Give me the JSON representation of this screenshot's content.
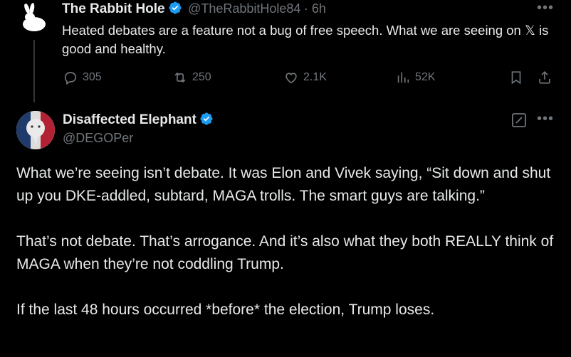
{
  "tweet1": {
    "author_name": "The Rabbit Hole",
    "handle": "@TheRabbitHole84",
    "time": "· 6h",
    "text": "Heated debates are a feature not a bug of free speech. What we are seeing on 𝕏 is good and healthy.",
    "stats": {
      "replies": "305",
      "reposts": "250",
      "likes": "2.1K",
      "views": "52K"
    }
  },
  "tweet2": {
    "author_name": "Disaffected Elephant",
    "handle": "@DEGOPer",
    "paragraphs": [
      "What we’re seeing isn’t debate. It was Elon and Vivek saying, “Sit down and shut up you DKE-addled, subtard, MAGA trolls. The smart guys are talking.”",
      "That’s not debate. That’s arrogance. And it’s also what they both REALLY think of MAGA when they’re not coddling Trump.",
      "If the last 48 hours occurred *before* the election, Trump loses."
    ]
  },
  "colors": {
    "background": "#000000",
    "text": "#e7e9ea",
    "muted": "#71767b",
    "verified": "#1d9bf0"
  },
  "icons": [
    "rabbit-avatar",
    "verified-badge-icon",
    "more-icon",
    "reply-icon",
    "repost-icon",
    "like-icon",
    "views-icon",
    "bookmark-icon",
    "share-icon",
    "edit-icon"
  ]
}
